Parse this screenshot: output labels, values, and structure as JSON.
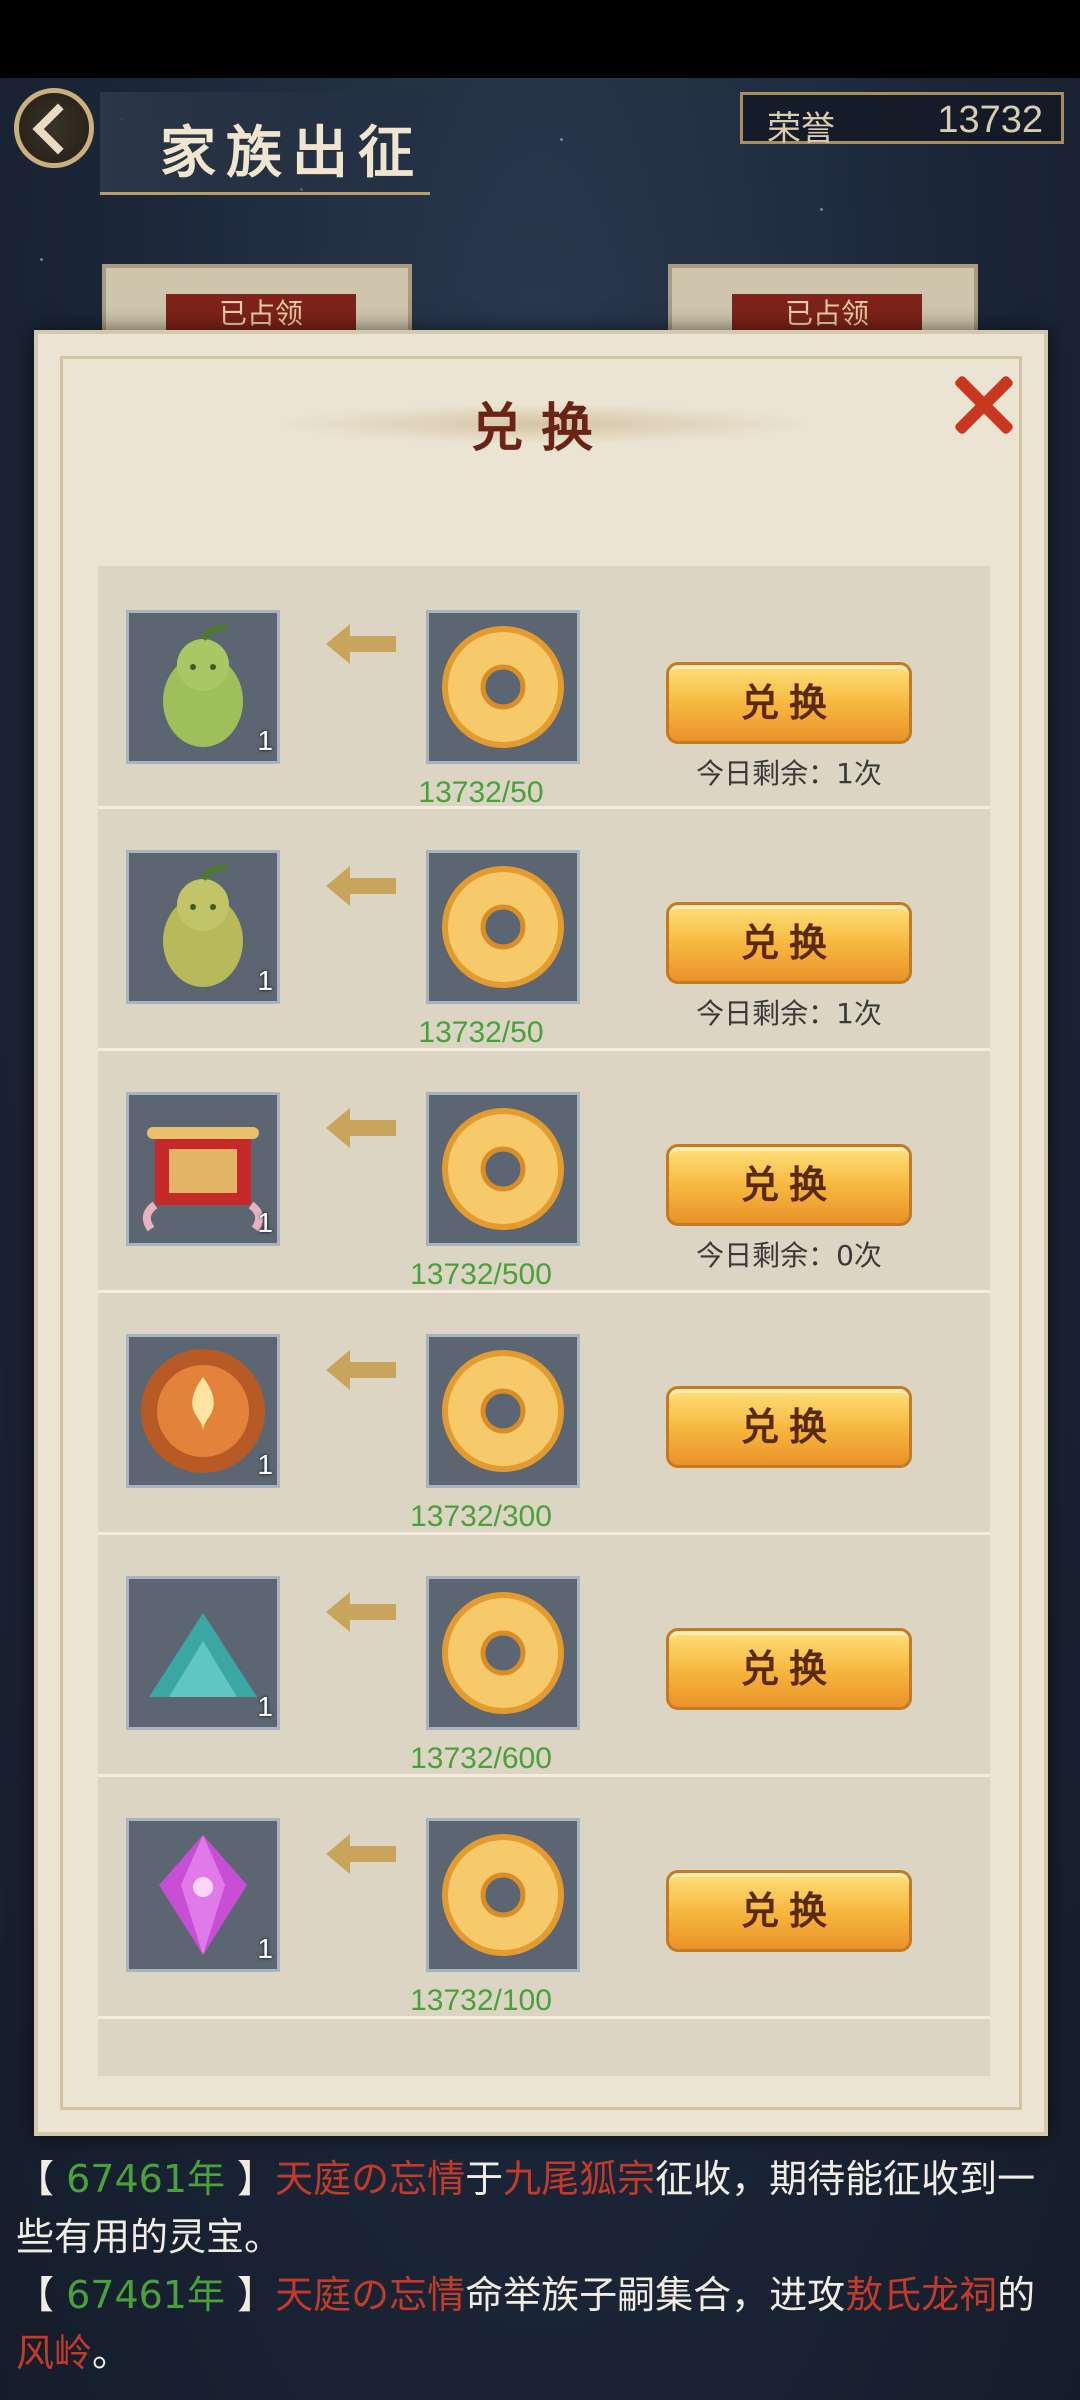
{
  "header": {
    "title": "家族出征",
    "honor_label": "荣誉",
    "honor_value": "13732"
  },
  "behind": {
    "tag_left": "已占领",
    "tag_right": "已占领"
  },
  "modal": {
    "title": "兑换",
    "rows": [
      {
        "item": "pear-baby",
        "item_count": "1",
        "cost": "13732/50",
        "button": "兑换",
        "remaining": "今日剩余：1次"
      },
      {
        "item": "pear-baby-gold",
        "item_count": "1",
        "cost": "13732/50",
        "button": "兑换",
        "remaining": "今日剩余：1次"
      },
      {
        "item": "red-scroll",
        "item_count": "1",
        "cost": "13732/500",
        "button": "兑换",
        "remaining": "今日剩余：0次"
      },
      {
        "item": "fire-orb",
        "item_count": "1",
        "cost": "13732/300",
        "button": "兑换",
        "remaining": ""
      },
      {
        "item": "teal-sand",
        "item_count": "1",
        "cost": "13732/600",
        "button": "兑换",
        "remaining": ""
      },
      {
        "item": "purple-crystal",
        "item_count": "1",
        "cost": "13732/100",
        "button": "兑换",
        "remaining": ""
      }
    ]
  },
  "log": [
    {
      "year": "67461年",
      "actor": "天庭の忘情",
      "t1": "于",
      "place": "九尾狐宗",
      "t2": "征收，期待能征收到一些有用的灵宝。"
    },
    {
      "year": "67461年",
      "actor": "天庭の忘情",
      "t1": "命举族子嗣集合，进攻",
      "place": "敖氏龙祠",
      "t2": "的",
      "place2": "风岭",
      "t3": "。"
    }
  ],
  "colors": {
    "accent_gold": "#f6b53c",
    "cost_green": "#4aa13c",
    "title_red": "#6a2416",
    "close_red": "#c8371e"
  }
}
